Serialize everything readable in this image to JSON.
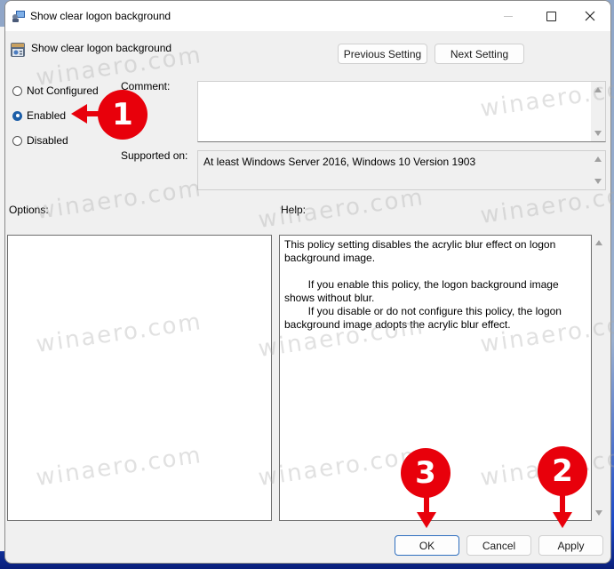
{
  "window": {
    "title": "Show clear logon background",
    "controls": {
      "minimize": "minimize",
      "maximize": "maximize",
      "close": "close"
    }
  },
  "header": {
    "policy_name": "Show clear logon background",
    "previous_button": "Previous Setting",
    "next_button": "Next Setting"
  },
  "state": {
    "options": [
      {
        "label": "Not Configured",
        "checked": false
      },
      {
        "label": "Enabled",
        "checked": true
      },
      {
        "label": "Disabled",
        "checked": false
      }
    ]
  },
  "comment": {
    "label": "Comment:",
    "value": ""
  },
  "supported": {
    "label": "Supported on:",
    "value": "At least Windows Server 2016, Windows 10 Version 1903"
  },
  "options_pane": {
    "label": "Options:"
  },
  "help_pane": {
    "label": "Help:",
    "text": "This policy setting disables the acrylic blur effect on logon background image.\n\n        If you enable this policy, the logon background image shows without blur.\n        If you disable or do not configure this policy, the logon background image adopts the acrylic blur effect."
  },
  "footer": {
    "ok": "OK",
    "cancel": "Cancel",
    "apply": "Apply"
  },
  "annotations": {
    "color": "#e8000b",
    "steps": [
      {
        "number": "1",
        "target": "Enabled"
      },
      {
        "number": "2",
        "target": "Apply"
      },
      {
        "number": "3",
        "target": "OK"
      }
    ]
  },
  "watermark": "winaero.com"
}
